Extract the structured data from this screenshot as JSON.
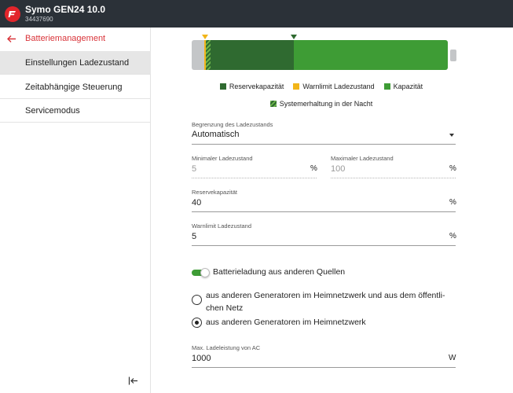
{
  "header": {
    "title": "Symo GEN24 10.0",
    "serial": "34437690",
    "brand_color": "#e2252b"
  },
  "sidebar": {
    "back_label": "Batteriemanagement",
    "items": [
      {
        "label": "Einstellungen Ladezustand",
        "active": true
      },
      {
        "label": "Zeitabhängige Steuerung",
        "active": false
      },
      {
        "label": "Servicemodus",
        "active": false
      }
    ]
  },
  "battery_bar": {
    "colors": {
      "reserve": "#2f6a30",
      "warnlimit": "#f2b519",
      "capacity": "#3e9c35",
      "unavailable": "#c4c6c8"
    },
    "legend": {
      "reserve": "Reservekapazität",
      "warnlimit": "Warnlimit Ladezustand",
      "capacity": "Kapazität",
      "night": "Systemerhaltung in der Nacht"
    }
  },
  "form": {
    "limit": {
      "label": "Begrenzung des Ladezustands",
      "value": "Automatisch"
    },
    "min_soc": {
      "label": "Minimaler Ladezustand",
      "value": "5",
      "unit": "%"
    },
    "max_soc": {
      "label": "Maximaler Ladezustand",
      "value": "100",
      "unit": "%"
    },
    "reserve": {
      "label": "Reservekapazität",
      "value": "40",
      "unit": "%"
    },
    "warnlimit": {
      "label": "Warnlimit Ladezustand",
      "value": "5",
      "unit": "%"
    },
    "toggle": {
      "label": "Batterieladung aus anderen Quellen",
      "on": true
    },
    "radio_options": [
      {
        "label_line1": "aus anderen Generatoren im Heimnetzwerk und aus dem öffentli-",
        "label_line2": "chen Netz",
        "selected": false
      },
      {
        "label_line1": "aus anderen Generatoren im Heimnetzwerk",
        "selected": true
      }
    ],
    "max_ac": {
      "label": "Max. Ladeleistung von AC",
      "value": "1000",
      "unit": "W"
    }
  }
}
